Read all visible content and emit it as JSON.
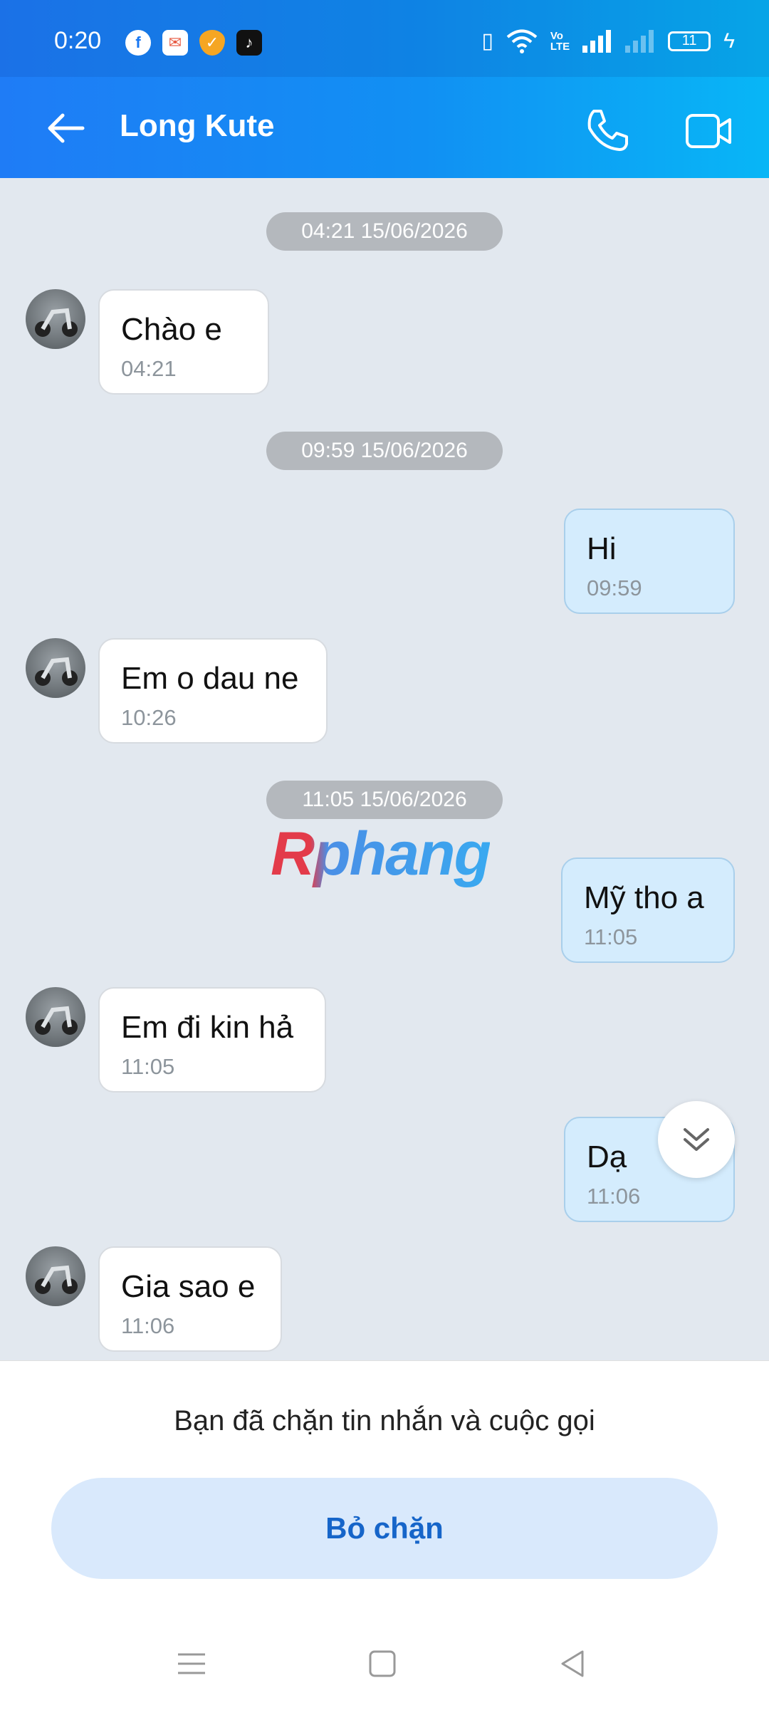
{
  "status_bar": {
    "time": "0:20",
    "battery": "11",
    "apps": [
      "facebook-icon",
      "mail-app-icon",
      "shield-app-icon",
      "tiktok-icon"
    ]
  },
  "header": {
    "contact_name": "Long Kute"
  },
  "messages": [
    {
      "type": "date",
      "text": "04:21 15/06/2026"
    },
    {
      "type": "incoming",
      "text": "Chào e",
      "time": "04:21"
    },
    {
      "type": "date",
      "text": "09:59 15/06/2026"
    },
    {
      "type": "outgoing",
      "text": "Hi",
      "time": "09:59"
    },
    {
      "type": "incoming",
      "text": "Em o dau ne",
      "time": "10:26"
    },
    {
      "type": "date",
      "text": "11:05 15/06/2026"
    },
    {
      "type": "outgoing",
      "text": "Mỹ tho a",
      "time": "11:05"
    },
    {
      "type": "incoming",
      "text": "Em đi kin hả",
      "time": "11:05"
    },
    {
      "type": "outgoing",
      "text": "Dạ",
      "time": "11:06"
    },
    {
      "type": "incoming",
      "text": "Gia sao e",
      "time": "11:06"
    }
  ],
  "watermark": "Rphang",
  "footer": {
    "blocked_notice": "Bạn đã chặn tin nhắn và cuộc gọi",
    "unblock_label": "Bỏ chặn"
  },
  "colors": {
    "header_start": "#1f7cf6",
    "header_end": "#08b6f6",
    "chat_bg": "#e2e8ef",
    "outgoing_bubble": "#d4ecfd",
    "unblock_bg": "#d9e9fc",
    "unblock_text": "#1665c9"
  }
}
